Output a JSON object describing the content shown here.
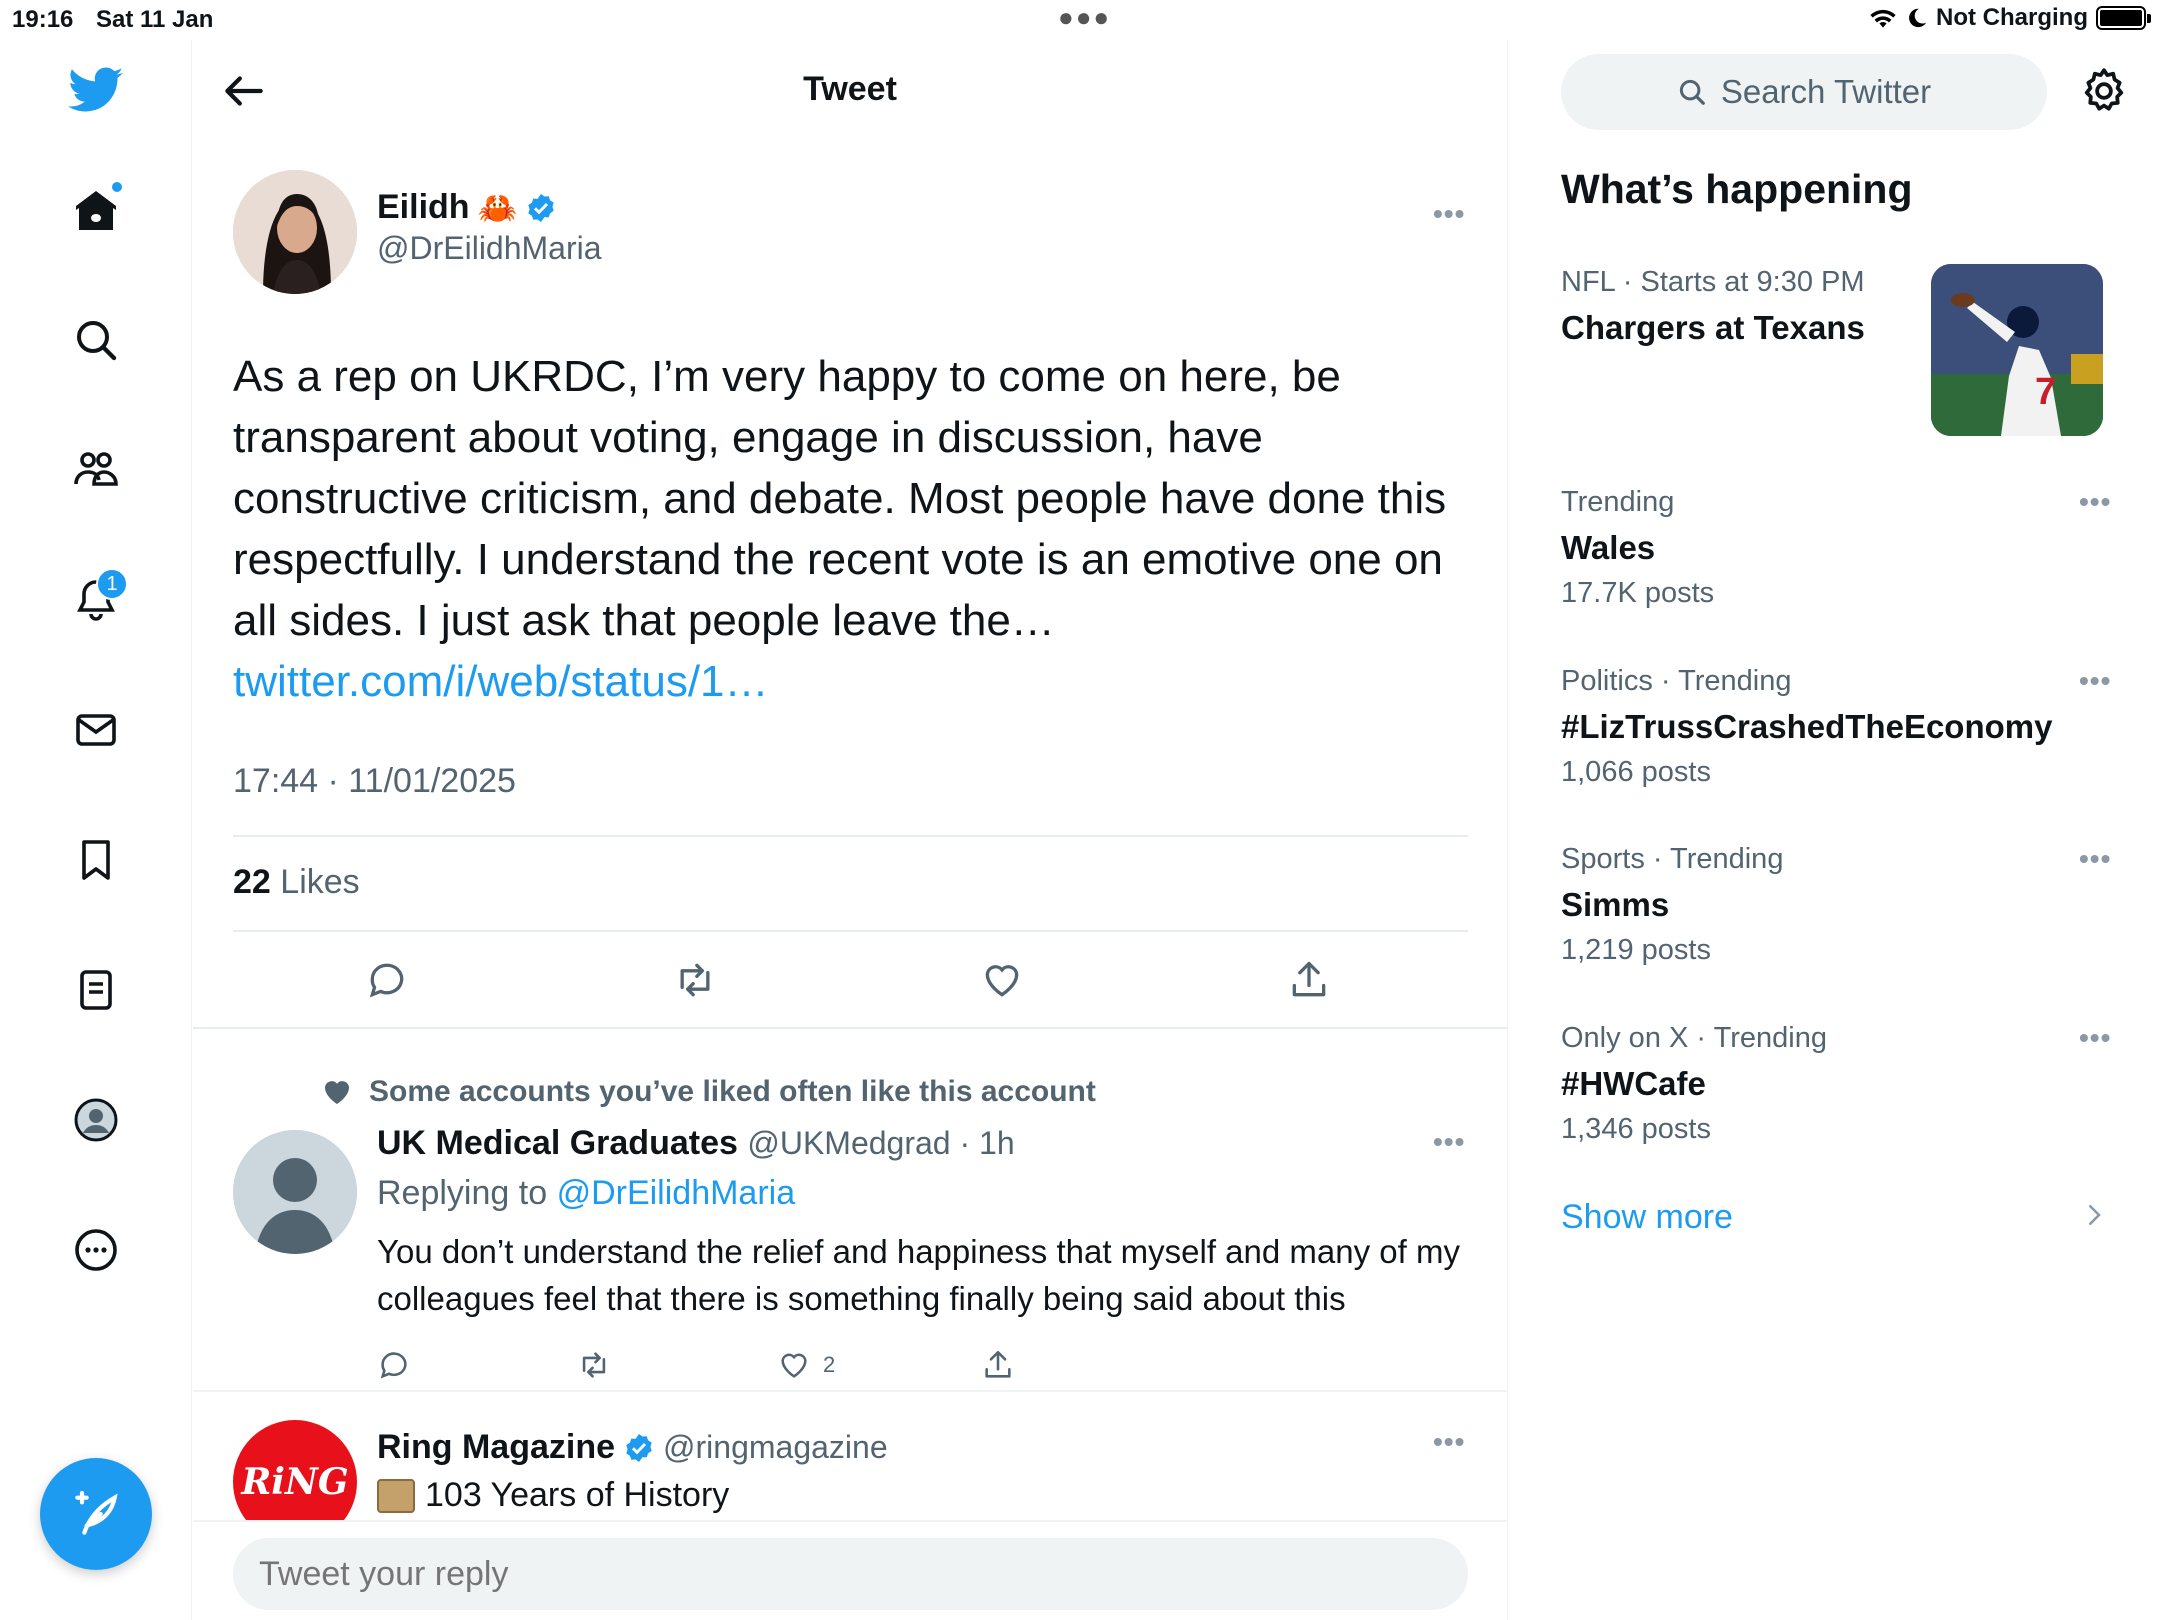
{
  "status_bar": {
    "time": "19:16",
    "date": "Sat 11 Jan",
    "battery": "Not Charging"
  },
  "header": {
    "title": "Tweet"
  },
  "tweet": {
    "author_name": "Eilidh",
    "author_emoji": "🦀",
    "author_handle": "@DrEilidhMaria",
    "text": "As a rep on UKRDC, I’m very happy to come on here, be transparent about voting, engage in discussion, have constructive criticism, and debate. Most people have done this respectfully. I understand the recent vote is an emotive one on all sides. I just ask that people leave the…",
    "link": "twitter.com/i/web/status/1…",
    "timestamp": "17:44 · 11/01/2025",
    "likes_count": "22",
    "likes_label": "Likes"
  },
  "reply": {
    "context": "Some accounts you’ve liked often like this account",
    "name": "UK Medical Graduates",
    "handle_time": "@UKMedgrad · 1h",
    "replying_label": "Replying to",
    "replying_handle": "@DrEilidhMaria",
    "text": "You don’t understand the relief and happiness that myself and many of my colleagues feel that there is something finally being said about this",
    "like_count": "2"
  },
  "ring_post": {
    "name": "Ring Magazine",
    "handle": "@ringmagazine",
    "avatar_text": "RiNG",
    "text": "103 Years of History"
  },
  "reply_bar": {
    "placeholder": "Tweet your reply"
  },
  "nav": {
    "notifications_badge": "1"
  },
  "sidebar": {
    "search_placeholder": "Search Twitter",
    "title": "What’s happening",
    "trends": [
      {
        "category": "NFL · Starts at 9:30 PM",
        "name": "Chargers at Texans",
        "count": ""
      },
      {
        "category": "Trending",
        "name": "Wales",
        "count": "17.7K posts"
      },
      {
        "category": "Politics · Trending",
        "name": "#LizTrussCrashedTheEconomy",
        "count": "1,066 posts"
      },
      {
        "category": "Sports · Trending",
        "name": "Simms",
        "count": "1,219 posts"
      },
      {
        "category": "Only on X · Trending",
        "name": "#HWCafe",
        "count": "1,346 posts"
      }
    ],
    "show_more": "Show more"
  },
  "colors": {
    "accent": "#1d9bf0",
    "text": "#0f1419",
    "muted": "#536471",
    "divider": "#eff3f4"
  }
}
